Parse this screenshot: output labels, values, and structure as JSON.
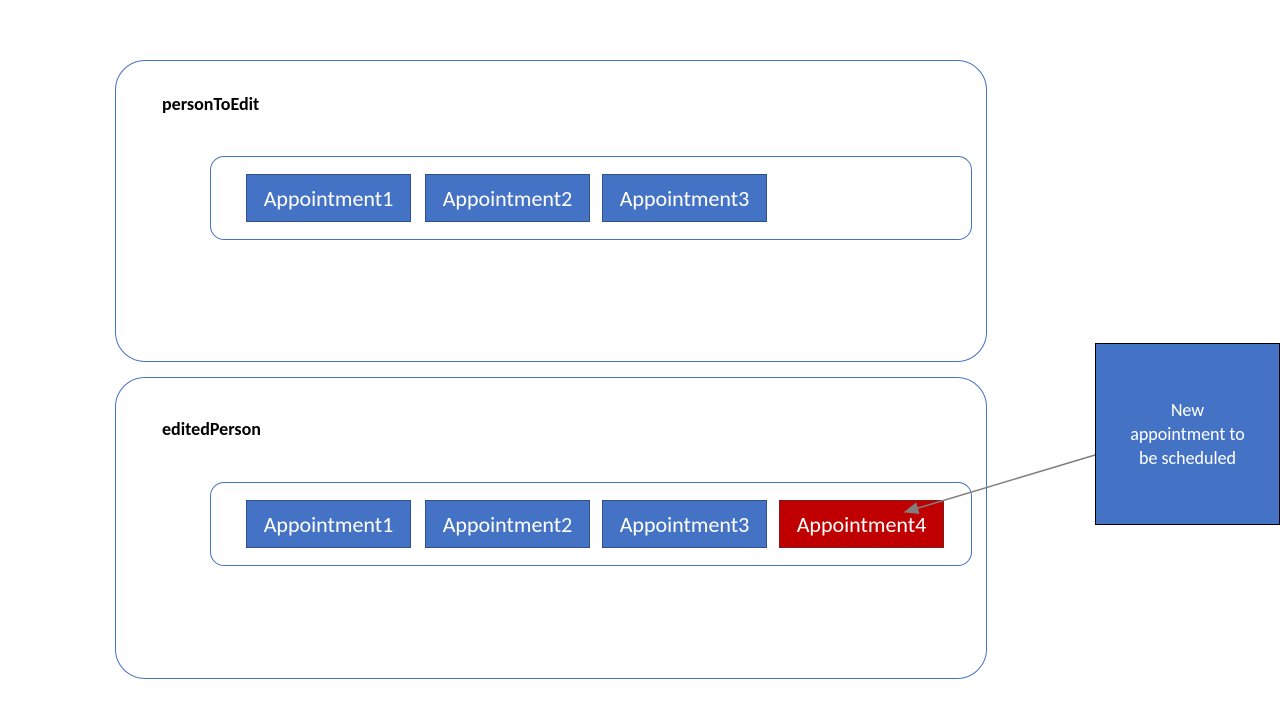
{
  "colors": {
    "blue": "#4472C4",
    "darkBlue": "#2F528F",
    "red": "#C00000",
    "arrow": "#7F7F7F"
  },
  "boxes": {
    "top": {
      "label": "personToEdit",
      "appointments": [
        {
          "label": "Appointment1",
          "color": "blue"
        },
        {
          "label": "Appointment2",
          "color": "blue"
        },
        {
          "label": "Appointment3",
          "color": "blue"
        }
      ]
    },
    "bottom": {
      "label": "editedPerson",
      "appointments": [
        {
          "label": "Appointment1",
          "color": "blue"
        },
        {
          "label": "Appointment2",
          "color": "blue"
        },
        {
          "label": "Appointment3",
          "color": "blue"
        },
        {
          "label": "Appointment4",
          "color": "red"
        }
      ]
    }
  },
  "callout": {
    "line1": "New",
    "line2": "appointment to",
    "line3": "be scheduled"
  }
}
